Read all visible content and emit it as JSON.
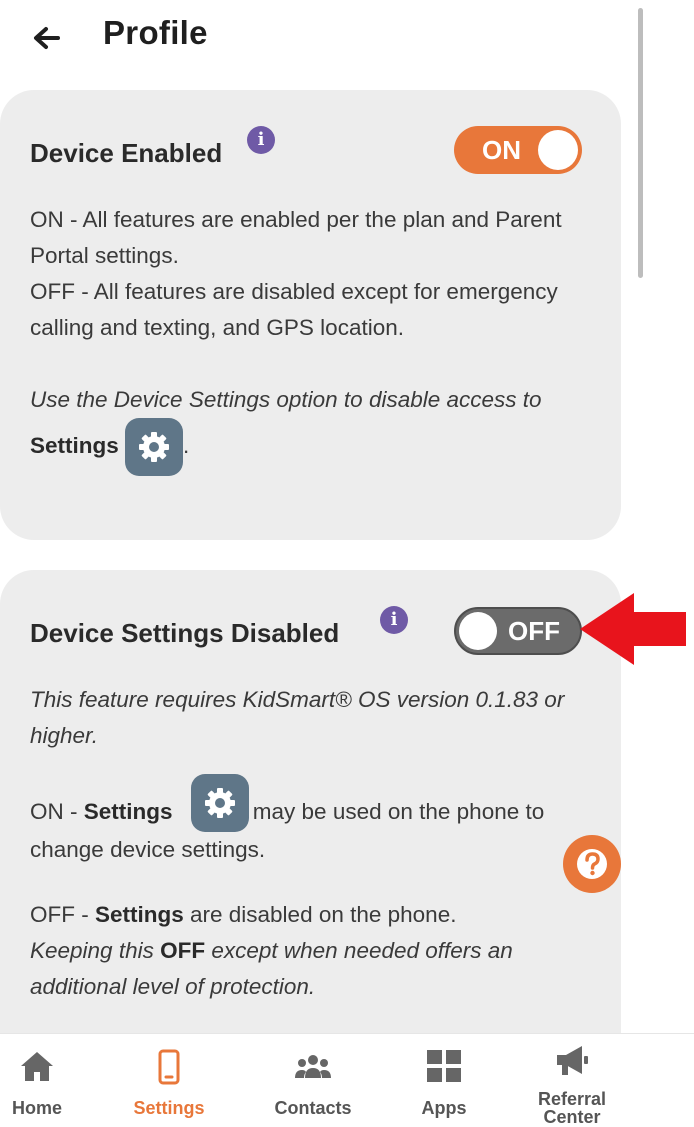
{
  "header": {
    "title": "Profile",
    "back_icon": "arrow-left-icon"
  },
  "device_enabled": {
    "title": "Device Enabled",
    "toggle_label": "ON",
    "toggle_state": "on",
    "line_on": "ON - All features are enabled per the plan and Parent Portal settings.",
    "line_off": "OFF - All features are disabled except for emergency calling and texting, and GPS location.",
    "note_prefix": "Use the Device Settings option to disable access to ",
    "note_bold": "Settings",
    "note_suffix": "."
  },
  "device_settings_disabled": {
    "title": "Device Settings Disabled",
    "toggle_label": "OFF",
    "toggle_state": "off",
    "requirement": "This feature requires KidSmart® OS version 0.1.83 or higher.",
    "on_prefix": "ON - ",
    "on_bold": "Settings",
    "on_suffix": "may be used on the phone to change device settings.",
    "off_prefix": "OFF - ",
    "off_bold": "Settings",
    "off_suffix": " are disabled on the phone.",
    "keep_prefix": "Keeping this ",
    "keep_bold": "OFF",
    "keep_suffix": " except when needed offers an additional level of protection."
  },
  "nav": {
    "items": [
      {
        "label": "Home",
        "icon": "home-icon"
      },
      {
        "label": "Settings",
        "icon": "phone-icon",
        "active": true
      },
      {
        "label": "Contacts",
        "icon": "contacts-icon"
      },
      {
        "label": "Apps",
        "icon": "apps-grid-icon"
      },
      {
        "label": "Referral Center",
        "icon": "megaphone-icon"
      }
    ]
  },
  "colors": {
    "accent": "#e8773a",
    "info": "#6f5aa6",
    "gear_tile": "#5f7688",
    "annotation_arrow": "#e8141c"
  }
}
